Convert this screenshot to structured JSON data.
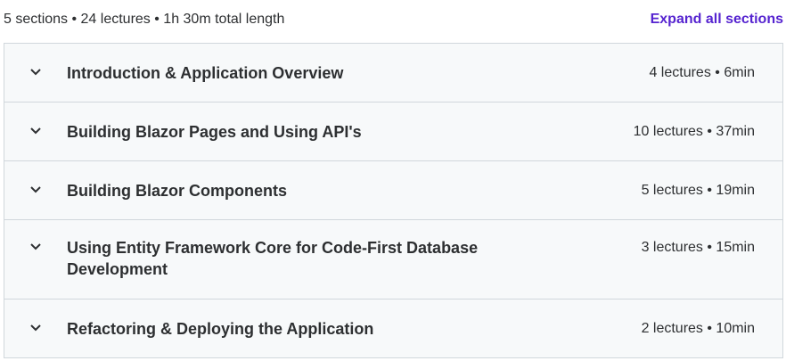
{
  "summary": {
    "text": "5 sections • 24 lectures • 1h 30m total length",
    "expand_label": "Expand all sections"
  },
  "sections": [
    {
      "title": "Introduction & Application Overview",
      "meta": "4 lectures • 6min"
    },
    {
      "title": "Building Blazor Pages and Using API's",
      "meta": "10 lectures • 37min"
    },
    {
      "title": "Building Blazor Components",
      "meta": "5 lectures • 19min"
    },
    {
      "title": "Using Entity Framework Core for Code-First Database Development",
      "meta": "3 lectures • 15min"
    },
    {
      "title": "Refactoring & Deploying the Application",
      "meta": "2 lectures • 10min"
    }
  ],
  "colors": {
    "accent": "#5624d0",
    "section_bg": "#f7f9fa",
    "border": "#d1d7dc"
  },
  "icons": {
    "section_toggle": "chevron-down-icon"
  }
}
